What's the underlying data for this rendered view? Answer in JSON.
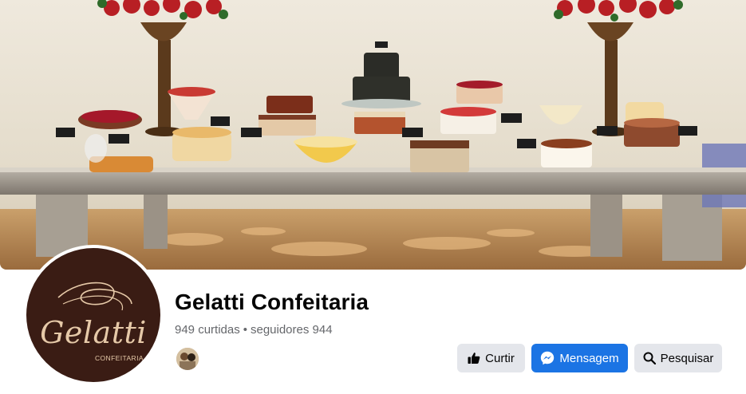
{
  "page": {
    "name": "Gelatti Confeitaria",
    "likes": "949 curtidas",
    "separator": "•",
    "followers": "seguidores 944"
  },
  "logo": {
    "name": "Gelatti",
    "subtitle": "CONFEITARIA"
  },
  "actions": {
    "like_label": "Curtir",
    "message_label": "Mensagem",
    "search_label": "Pesquisar"
  },
  "icons": {
    "like": "thumbs-up-icon",
    "message": "messenger-icon",
    "search": "search-icon"
  },
  "colors": {
    "primary_button": "#1b74e4",
    "secondary_button": "#e4e6eb",
    "secondary_text": "#65676b",
    "logo_background": "#3a1c14",
    "logo_text": "#e6c9a8"
  }
}
